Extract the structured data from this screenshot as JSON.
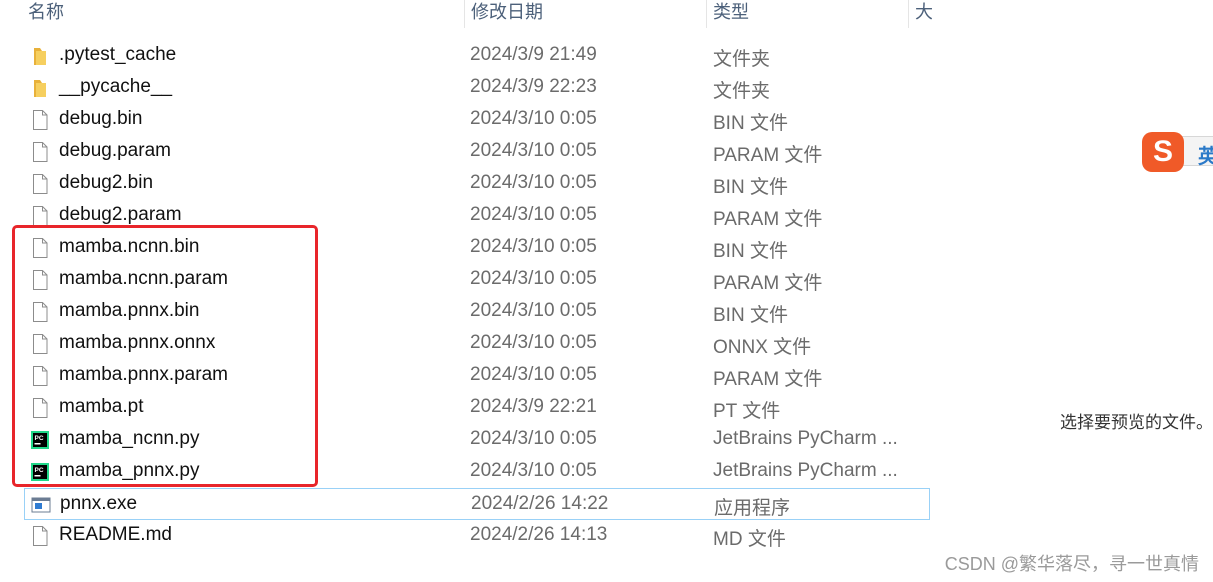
{
  "header": {
    "name": "名称",
    "date": "修改日期",
    "type": "类型",
    "size": "大"
  },
  "files": [
    {
      "name": ".pytest_cache",
      "date": "2024/3/9 21:49",
      "type": "文件夹",
      "icon": "folder-icon"
    },
    {
      "name": "__pycache__",
      "date": "2024/3/9 22:23",
      "type": "文件夹",
      "icon": "folder-icon"
    },
    {
      "name": "debug.bin",
      "date": "2024/3/10 0:05",
      "type": "BIN 文件",
      "icon": "file-icon"
    },
    {
      "name": "debug.param",
      "date": "2024/3/10 0:05",
      "type": "PARAM 文件",
      "icon": "file-icon"
    },
    {
      "name": "debug2.bin",
      "date": "2024/3/10 0:05",
      "type": "BIN 文件",
      "icon": "file-icon"
    },
    {
      "name": "debug2.param",
      "date": "2024/3/10 0:05",
      "type": "PARAM 文件",
      "icon": "file-icon"
    },
    {
      "name": "mamba.ncnn.bin",
      "date": "2024/3/10 0:05",
      "type": "BIN 文件",
      "icon": "file-icon"
    },
    {
      "name": "mamba.ncnn.param",
      "date": "2024/3/10 0:05",
      "type": "PARAM 文件",
      "icon": "file-icon"
    },
    {
      "name": "mamba.pnnx.bin",
      "date": "2024/3/10 0:05",
      "type": "BIN 文件",
      "icon": "file-icon"
    },
    {
      "name": "mamba.pnnx.onnx",
      "date": "2024/3/10 0:05",
      "type": "ONNX 文件",
      "icon": "file-icon"
    },
    {
      "name": "mamba.pnnx.param",
      "date": "2024/3/10 0:05",
      "type": "PARAM 文件",
      "icon": "file-icon"
    },
    {
      "name": "mamba.pt",
      "date": "2024/3/9 22:21",
      "type": "PT 文件",
      "icon": "file-icon"
    },
    {
      "name": "mamba_ncnn.py",
      "date": "2024/3/10 0:05",
      "type": "JetBrains PyCharm ...",
      "icon": "pycharm-icon"
    },
    {
      "name": "mamba_pnnx.py",
      "date": "2024/3/10 0:05",
      "type": "JetBrains PyCharm ...",
      "icon": "pycharm-icon"
    },
    {
      "name": "pnnx.exe",
      "date": "2024/2/26 14:22",
      "type": "应用程序",
      "icon": "exe-icon"
    },
    {
      "name": "README.md",
      "date": "2024/2/26 14:13",
      "type": "MD 文件",
      "icon": "file-icon"
    }
  ],
  "preview": {
    "message": "选择要预览的文件。"
  },
  "ime": {
    "logo_char": "S",
    "mode_char": "英"
  },
  "watermark": "CSDN @繁华落尽，寻一世真情",
  "colors": {
    "highlight": "#e8252a",
    "folder": "#f3c34e",
    "pycharm_green": "#21d789"
  }
}
